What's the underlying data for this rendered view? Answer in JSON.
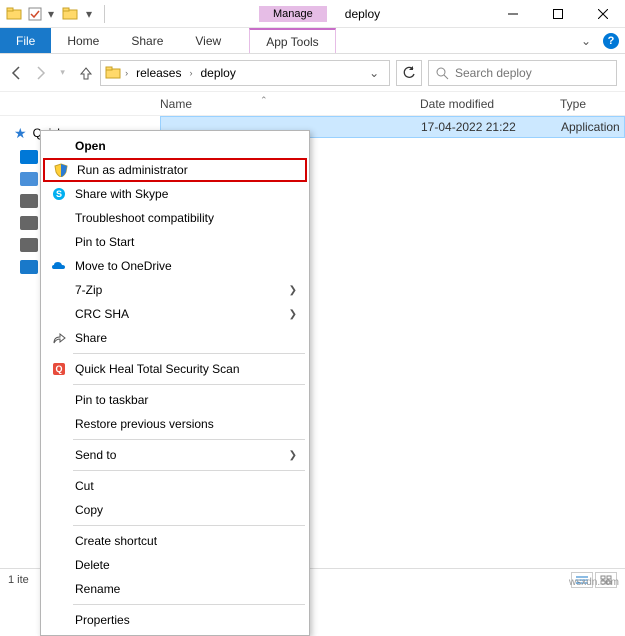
{
  "titlebar": {
    "manage_label": "Manage",
    "title": "deploy"
  },
  "ribbon": {
    "file": "File",
    "home": "Home",
    "share": "Share",
    "view": "View",
    "app_tools": "App Tools"
  },
  "address": {
    "crumbs": [
      "releases",
      "deploy"
    ]
  },
  "search": {
    "placeholder": "Search deploy"
  },
  "columns": {
    "name": "Name",
    "date": "Date modified",
    "type": "Type"
  },
  "sidebar": {
    "quick_access": "Quick access"
  },
  "files": [
    {
      "name": "",
      "date": "17-04-2022 21:22",
      "type": "Application"
    }
  ],
  "context_menu": {
    "open": "Open",
    "run_as_admin": "Run as administrator",
    "share_skype": "Share with Skype",
    "troubleshoot": "Troubleshoot compatibility",
    "pin_start": "Pin to Start",
    "onedrive": "Move to OneDrive",
    "sevenzip": "7-Zip",
    "crc_sha": "CRC SHA",
    "share": "Share",
    "quick_heal": "Quick Heal Total Security Scan",
    "pin_taskbar": "Pin to taskbar",
    "restore": "Restore previous versions",
    "send_to": "Send to",
    "cut": "Cut",
    "copy": "Copy",
    "shortcut": "Create shortcut",
    "delete": "Delete",
    "rename": "Rename",
    "properties": "Properties"
  },
  "status": {
    "text": "1 ite"
  },
  "watermark": "wsxdn.com"
}
